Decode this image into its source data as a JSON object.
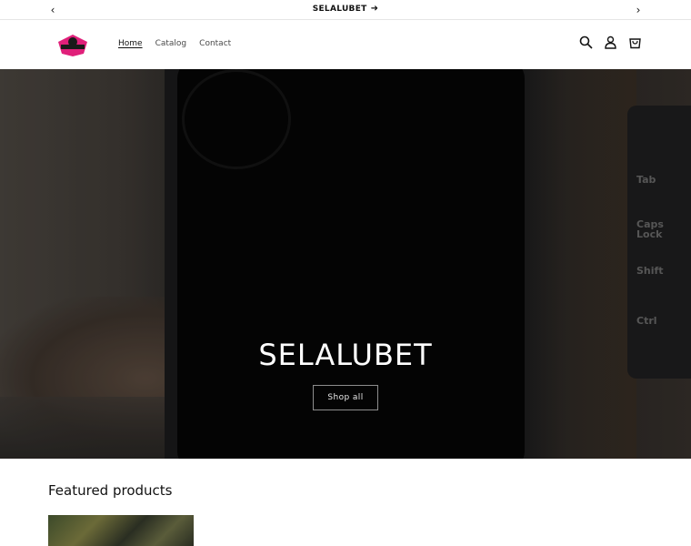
{
  "announcement": {
    "text": "SELALUBET",
    "prev_icon": "chevron-left-icon",
    "next_icon": "chevron-right-icon"
  },
  "header": {
    "logo_alt": "logo",
    "nav": [
      {
        "label": "Home",
        "active": true
      },
      {
        "label": "Catalog",
        "active": false
      },
      {
        "label": "Contact",
        "active": false
      }
    ],
    "icons": [
      "search-icon",
      "account-icon",
      "cart-icon"
    ]
  },
  "hero": {
    "title": "SELALUBET",
    "button_label": "Shop all",
    "keys": [
      "Tab",
      "Caps Lock",
      "Shift",
      "Ctrl"
    ]
  },
  "featured": {
    "heading": "Featured products"
  }
}
